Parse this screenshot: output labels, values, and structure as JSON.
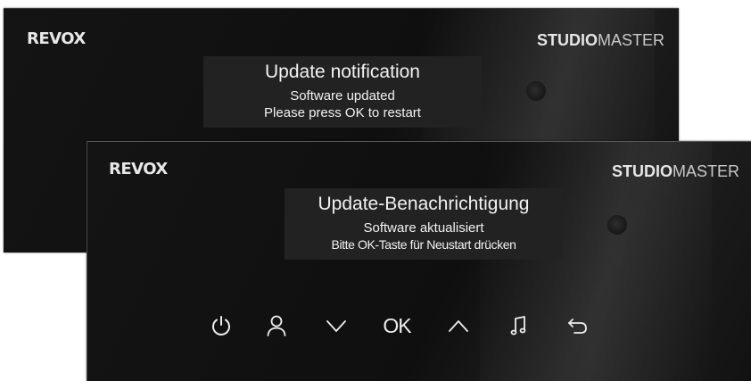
{
  "back_panel": {
    "logo": "REVOX",
    "brand_bold": "STUDIO",
    "brand_light": "MASTER",
    "notification": {
      "title": "Update notification",
      "line1": "Software updated",
      "line2": "Please press OK to restart"
    }
  },
  "front_panel": {
    "logo": "REVOX",
    "brand_bold": "STUDIO",
    "brand_light": "MASTER",
    "notification": {
      "title": "Update-Benachrichtigung",
      "line1": "Software aktualisiert",
      "line2": "Bitte OK-Taste für Neustart drücken"
    },
    "controls": {
      "power_icon": "power-icon",
      "user_icon": "user-icon",
      "down_icon": "chevron-down-icon",
      "ok_label": "OK",
      "up_icon": "chevron-up-icon",
      "music_icon": "music-note-icon",
      "back_icon": "back-arrow-icon"
    }
  },
  "colors": {
    "panel_bg": "#121212",
    "notification_bg": "#222222",
    "text": "#f2f2f2"
  }
}
